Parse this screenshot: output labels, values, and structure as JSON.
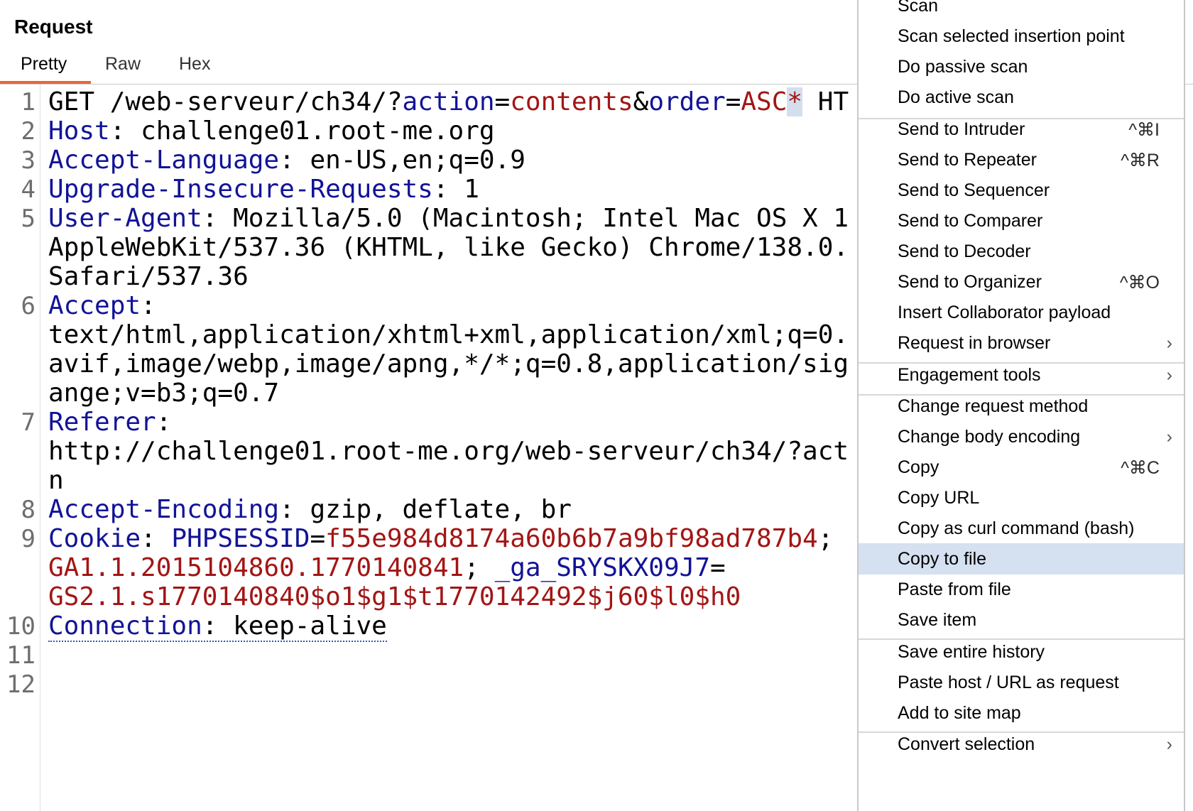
{
  "panel": {
    "title": "Request",
    "tabs": [
      "Pretty",
      "Raw",
      "Hex"
    ]
  },
  "editor": {
    "line_numbers": [
      "1",
      "2",
      "3",
      "4",
      "5",
      "6",
      "7",
      "8",
      "9",
      "10",
      "11",
      "12"
    ],
    "l1": {
      "method_path": "GET /web-serveur/ch34/?",
      "k1": "action",
      "eq1": "=",
      "v1": "contents",
      "amp": "&",
      "k2": "order",
      "eq2": "=",
      "v2": "ASC",
      "star": "*",
      "rest": " HT"
    },
    "l2": {
      "key": "Host",
      "sep": ": ",
      "val": "challenge01.root-me.org"
    },
    "l3": {
      "key": "Accept-Language",
      "sep": ": ",
      "val": "en-US,en;q=0.9"
    },
    "l4": {
      "key": "Upgrade-Insecure-Requests",
      "sep": ": ",
      "val": "1"
    },
    "l5": {
      "key": "User-Agent",
      "sep": ": ",
      "val": "Mozilla/5.0 (Macintosh; Intel Mac OS X 1",
      "wrap1": "AppleWebKit/537.36 (KHTML, like Gecko) Chrome/138.0.",
      "wrap2": "Safari/537.36"
    },
    "l6": {
      "key": "Accept",
      "sep": ":",
      "wrap1": "text/html,application/xhtml+xml,application/xml;q=0.",
      "wrap2": "avif,image/webp,image/apng,*/*;q=0.8,application/sig",
      "wrap3": "ange;v=b3;q=0.7"
    },
    "l7": {
      "key": "Referer",
      "sep": ":",
      "wrap1": "http://challenge01.root-me.org/web-serveur/ch34/?act",
      "wrap2": "n"
    },
    "l8": {
      "key": "Accept-Encoding",
      "sep": ": ",
      "val": "gzip, deflate, br"
    },
    "l9": {
      "key": "Cookie",
      "sep": ": ",
      "c1k": "PHPSESSID",
      "c1eq": "=",
      "c1v": "f55e984d8174a60b6b7a9bf98ad787b4",
      "c1semi": ";",
      "c2v": "GA1.1.2015104860.1770140841",
      "c2semi": "; ",
      "c3k": "_ga_SRYSKX09J7",
      "c3eq": "=",
      "c3v": "GS2.1.s1770140840$o1$g1$t1770142492$j60$l0$h0"
    },
    "l10": {
      "key": "Connection",
      "sep": ": ",
      "val": "keep-alive"
    }
  },
  "context_menu": {
    "items": [
      {
        "label": "Scan"
      },
      {
        "label": "Scan selected insertion point"
      },
      {
        "label": "Do passive scan"
      },
      {
        "label": "Do active scan"
      },
      {
        "label": "Send to Intruder",
        "shortcut": "^⌘I"
      },
      {
        "label": "Send to Repeater",
        "shortcut": "^⌘R"
      },
      {
        "label": "Send to Sequencer"
      },
      {
        "label": "Send to Comparer"
      },
      {
        "label": "Send to Decoder"
      },
      {
        "label": "Send to Organizer",
        "shortcut": "^⌘O"
      },
      {
        "label": "Insert Collaborator payload"
      },
      {
        "label": "Request in browser",
        "submenu_arrow": "›"
      },
      {
        "label": "Engagement tools",
        "submenu_arrow": "›"
      },
      {
        "label": "Change request method"
      },
      {
        "label": "Change body encoding",
        "submenu_arrow": "›"
      },
      {
        "label": "Copy",
        "shortcut": "^⌘C"
      },
      {
        "label": "Copy URL"
      },
      {
        "label": "Copy as curl command (bash)"
      },
      {
        "label": "Copy to file",
        "highlighted": true
      },
      {
        "label": "Paste from file"
      },
      {
        "label": "Save item"
      },
      {
        "label": "Save entire history"
      },
      {
        "label": "Paste host / URL as request"
      },
      {
        "label": "Add to site map"
      },
      {
        "label": "Convert selection",
        "submenu_arrow": "›"
      }
    ]
  },
  "colors": {
    "header_key": "#121397",
    "value_red": "#a31515",
    "tab_accent": "#e8663a",
    "menu_highlight": "#d5e0f0"
  }
}
